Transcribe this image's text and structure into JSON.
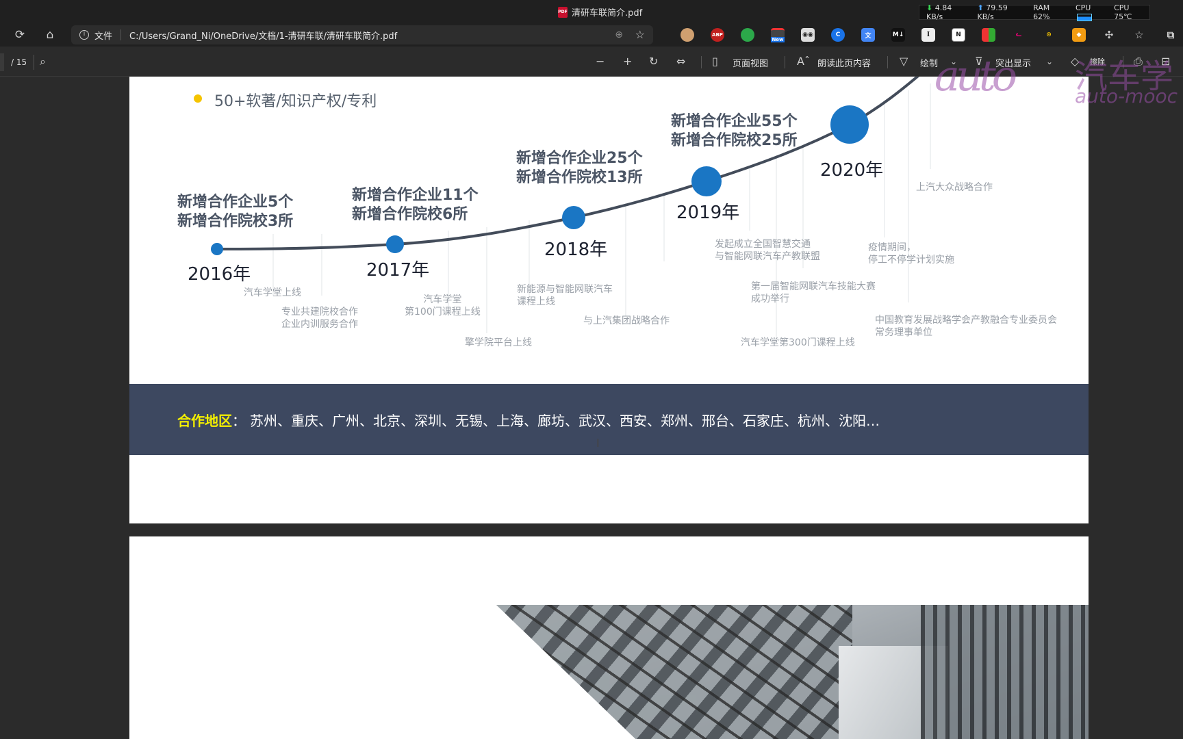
{
  "window": {
    "title": "清研车联简介.pdf",
    "sysmon": {
      "down": "4.84 KB/s",
      "up": "79.59 KB/s",
      "ram": "RAM 62%",
      "cpu_label": "CPU",
      "cpu_temp": "CPU 75℃"
    }
  },
  "addressbar": {
    "file_label": "文件",
    "url": "C:/Users/Grand_Ni/OneDrive/文档/1-清研车联/清研车联简介.pdf",
    "new_badge": "New",
    "abp_label": "ABP",
    "md_label": "M↓",
    "i_label": "I",
    "n_label": "N"
  },
  "pdftoolbar": {
    "page_total": "/ 15",
    "page_view": "页面视图",
    "read_aloud": "朗读此页内容",
    "draw": "绘制",
    "highlight": "突出显示",
    "erase": "擦除"
  },
  "watermark": {
    "logo": "auto",
    "cn": "汽车学",
    "en": "auto-mooc"
  },
  "page1": {
    "bullet": "50+软著/知识产权/专利",
    "years": [
      "2016年",
      "2017年",
      "2018年",
      "2019年",
      "2020年"
    ],
    "headlines": [
      "新增合作企业5个\n新增合作院校3所",
      "新增合作企业11个\n新增合作院校6所",
      "新增合作企业25个\n新增合作院校13所",
      "新增合作企业55个\n新增合作院校25所"
    ],
    "events": [
      "汽车学堂上线",
      "专业共建院校合作\n企业内训服务合作",
      "汽车学堂\n第100门课程上线",
      "擎学院平台上线",
      "新能源与智能网联汽车\n课程上线",
      "与上汽集团战略合作",
      "发起成立全国智慧交通\n与智能网联汽车产教联盟",
      "第一届智能网联汽车技能大赛\n成功举行",
      "汽车学堂第300门课程上线",
      "疫情期间，\n停工不停学计划实施",
      "上汽大众战略合作",
      "中国教育发展战略学会产教融合专业委员会\n常务理事单位"
    ],
    "region": {
      "label": "合作地区",
      "colon": "：",
      "list": "苏州、重庆、广州、北京、深圳、无锡、上海、廊坊、武汉、西安、郑州、邢台、石家庄、杭州、沈阳…"
    }
  },
  "colors": {
    "accent": "#1a76c4",
    "band": "#3d4860",
    "highlight_yellow": "#f5f000",
    "bullet_yellow": "#f5c400"
  }
}
